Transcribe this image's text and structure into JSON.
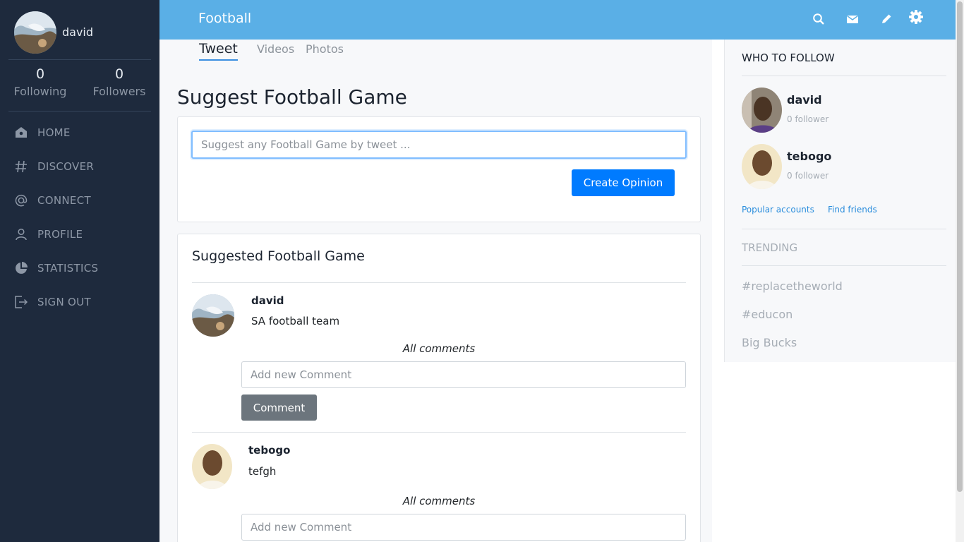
{
  "sidebar": {
    "username": "david",
    "following_count": "0",
    "following_label": "Following",
    "followers_count": "0",
    "followers_label": "Followers",
    "nav": [
      {
        "label": "HOME",
        "icon": "home-icon"
      },
      {
        "label": "DISCOVER",
        "icon": "hash-icon"
      },
      {
        "label": "CONNECT",
        "icon": "at-icon"
      },
      {
        "label": "PROFILE",
        "icon": "user-icon"
      },
      {
        "label": "STATISTICS",
        "icon": "pie-chart-icon"
      },
      {
        "label": "SIGN OUT",
        "icon": "sign-out-icon"
      }
    ]
  },
  "topbar": {
    "title": "Football",
    "icons": [
      "search-icon",
      "envelope-icon",
      "pencil-icon",
      "gear-icon"
    ]
  },
  "tabs": [
    {
      "label": "Tweet",
      "active": true
    },
    {
      "label": "Videos",
      "active": false
    },
    {
      "label": "Photos",
      "active": false
    }
  ],
  "main": {
    "page_title": "Suggest Football Game",
    "suggest_placeholder": "Suggest any Football Game by tweet ...",
    "create_button": "Create Opinion",
    "feed_title": "Suggested Football Game",
    "posts": [
      {
        "author": "david",
        "text": "SA football team",
        "all_comments": "All comments",
        "comment_placeholder": "Add new Comment",
        "comment_button": "Comment"
      },
      {
        "author": "tebogo",
        "text": "tefgh",
        "all_comments": "All comments",
        "comment_placeholder": "Add new Comment"
      }
    ]
  },
  "right": {
    "who_to_follow": "WHO TO FOLLOW",
    "suggestions": [
      {
        "name": "david",
        "followers": "0 follower"
      },
      {
        "name": "tebogo",
        "followers": "0 follower"
      }
    ],
    "links": [
      "Popular accounts",
      "Find friends"
    ],
    "trending_label": "TRENDING",
    "trends": [
      "#replacetheworld",
      "#educon",
      "Big Bucks"
    ]
  },
  "colors": {
    "sidebar_bg": "#1e2a3d",
    "topbar_bg": "#5aafe6",
    "primary": "#007bff",
    "secondary": "#6c757d",
    "link": "#2a8ddc"
  }
}
